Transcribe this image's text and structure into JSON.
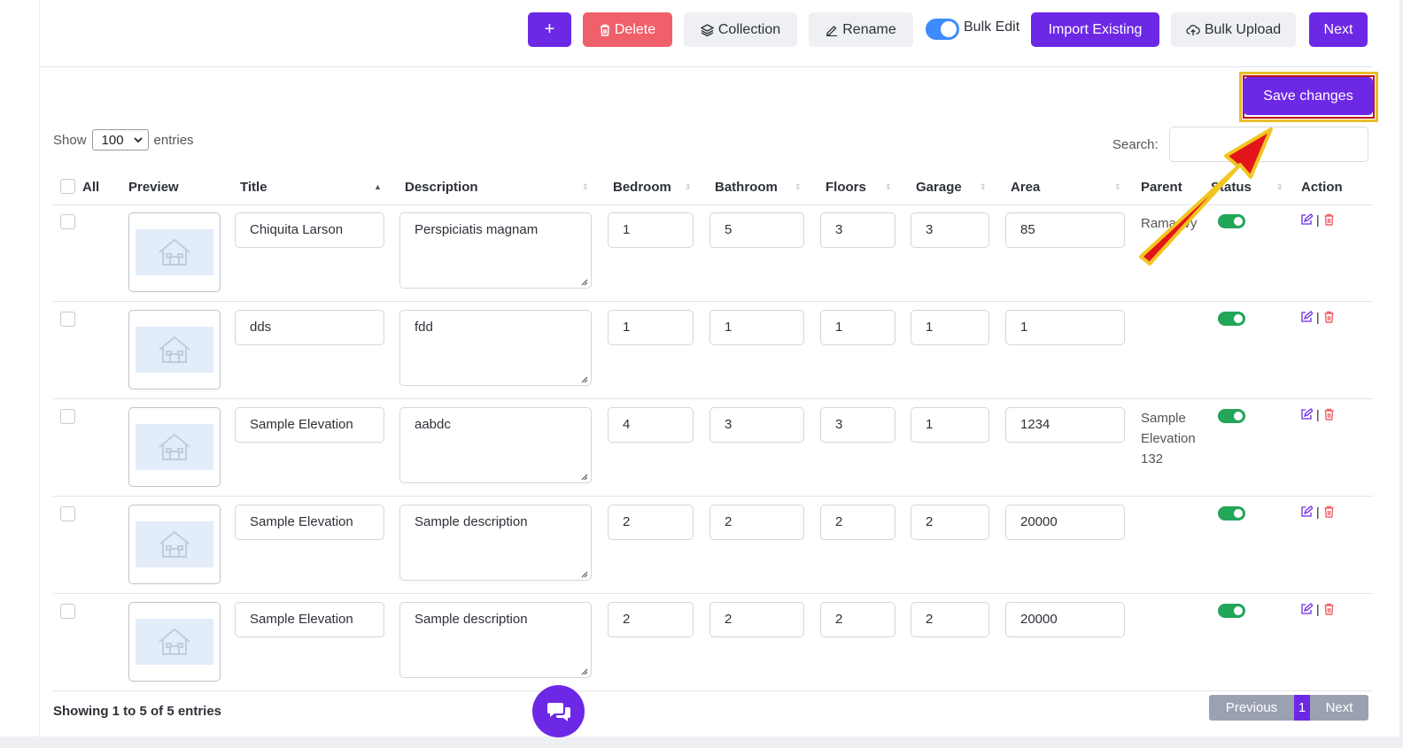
{
  "toolbar": {
    "add_label": "+",
    "delete_label": "Delete",
    "collection_label": "Collection",
    "rename_label": "Rename",
    "bulk_edit_label": "Bulk Edit",
    "bulk_edit_on": true,
    "import_label": "Import Existing",
    "bulk_upload_label": "Bulk Upload",
    "next_label": "Next"
  },
  "save_label": "Save changes",
  "length": {
    "show": "Show",
    "value": "100",
    "entries": "entries"
  },
  "search": {
    "label": "Search:",
    "value": ""
  },
  "columns": {
    "all": "All",
    "preview": "Preview",
    "title": "Title",
    "description": "Description",
    "bedroom": "Bedroom",
    "bathroom": "Bathroom",
    "floors": "Floors",
    "garage": "Garage",
    "area": "Area",
    "parent": "Parent",
    "status": "Status",
    "action": "Action"
  },
  "rows": [
    {
      "title": "Chiquita Larson",
      "description": "Perspiciatis magnam",
      "bedroom": "1",
      "bathroom": "5",
      "floors": "3",
      "garage": "3",
      "area": "85",
      "parent": "Rama Ivy",
      "status": true
    },
    {
      "title": "dds",
      "description": "fdd",
      "bedroom": "1",
      "bathroom": "1",
      "floors": "1",
      "garage": "1",
      "area": "1",
      "parent": "",
      "status": true
    },
    {
      "title": "Sample Elevation",
      "description": "aabdc",
      "bedroom": "4",
      "bathroom": "3",
      "floors": "3",
      "garage": "1",
      "area": "1234",
      "parent": "Sample Elevation 132",
      "status": true
    },
    {
      "title": "Sample Elevation",
      "description": "Sample description",
      "bedroom": "2",
      "bathroom": "2",
      "floors": "2",
      "garage": "2",
      "area": "20000",
      "parent": "",
      "status": true
    },
    {
      "title": "Sample Elevation",
      "description": "Sample description",
      "bedroom": "2",
      "bathroom": "2",
      "floors": "2",
      "garage": "2",
      "area": "20000",
      "parent": "",
      "status": true
    }
  ],
  "footer": {
    "info": "Showing 1 to 5 of 5 entries",
    "previous": "Previous",
    "page": "1",
    "next": "Next"
  },
  "colors": {
    "primary": "#6d28e6",
    "danger": "#f0606a",
    "success": "#23a55a",
    "annotation_arrow": "#e3151a"
  }
}
